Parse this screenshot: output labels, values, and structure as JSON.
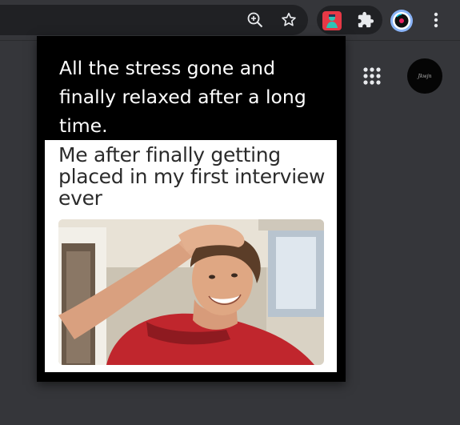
{
  "toolbar": {
    "icons": [
      "zoom-icon",
      "bookmark-star-icon",
      "extension-meme-icon",
      "puzzle-extensions-icon",
      "profile-avatar",
      "more-menu-icon"
    ]
  },
  "page": {
    "account_label": "Jkwjn"
  },
  "popup": {
    "caption": "All the stress gone and finally relaxed after a long time.",
    "meme_text": "Me after finally getting placed in my first interview ever",
    "image_description": "meme-photo"
  }
}
